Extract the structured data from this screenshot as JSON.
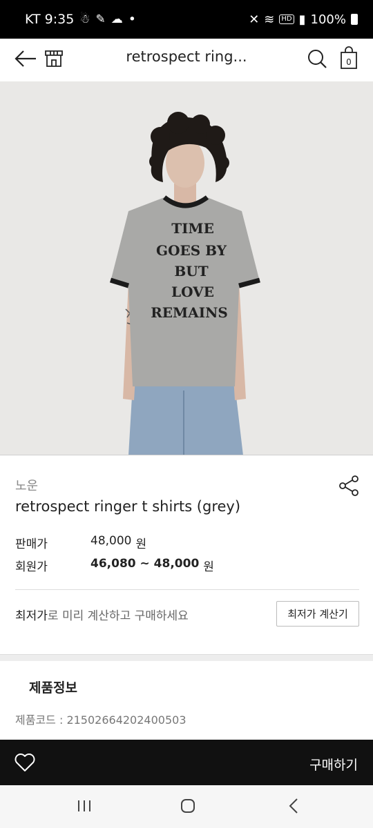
{
  "status": {
    "carrier_time": "KT 9:35",
    "notification_icons": [
      "app-icon",
      "app-icon",
      "app-icon"
    ],
    "dot": "•",
    "battery": "100%",
    "hd": "HD"
  },
  "header": {
    "title": "retrospect ring..."
  },
  "hero": {
    "shirt_text": [
      "TIME",
      "GOES BY",
      "BUT",
      "LOVE",
      "REMAINS"
    ]
  },
  "product": {
    "brand": "노운",
    "name": "retrospect ringer t shirts (grey)",
    "price_label": "판매가",
    "price_value": "48,000",
    "price_unit": "원",
    "member_label": "회원가",
    "member_value": "46,080 ~ 48,000",
    "member_unit": "원"
  },
  "calc": {
    "highlight": "최저가",
    "rest": "로 미리 계산하고 구매하세요",
    "button_label": "최저가 계산기"
  },
  "info": {
    "section_title": "제품정보",
    "code_line": "제품코드 : 21502664202400503"
  },
  "buybar": {
    "buy_label": "구매하기"
  },
  "colors": {
    "bar_bg": "#111111",
    "hero_bg": "#e9e8e6",
    "shirt": "#a9a9a7"
  }
}
